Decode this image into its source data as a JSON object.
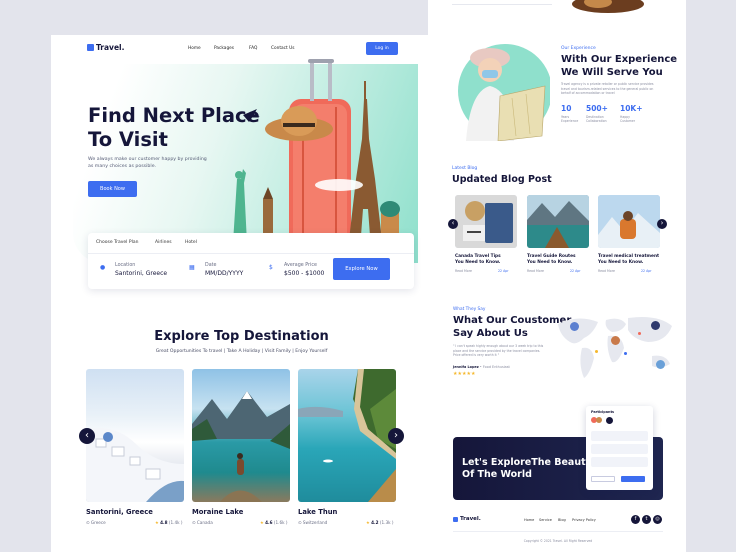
{
  "nav": {
    "logo": "Travel.",
    "links": [
      "Home",
      "Packages",
      "FAQ",
      "Contact Us"
    ],
    "login": "Log in"
  },
  "hero": {
    "title_line1": "Find Next Place",
    "title_line2": "To Visit",
    "subtitle_line1": "We always make our customer happy by providing",
    "subtitle_line2": "as many choices as possible.",
    "cta": "Book Now"
  },
  "search": {
    "tabs": [
      "Choose Travel Plan",
      "Airlines",
      "Hotel"
    ],
    "location_label": "Location",
    "location_value": "Santorini, Greece",
    "date_label": "Date",
    "date_value": "MM/DD/YYYY",
    "price_label": "Average Price",
    "price_value": "$500 - $1000",
    "button": "Explore Now"
  },
  "explore": {
    "title": "Explore Top Destination",
    "subtitle": "Great Opportunities To travel | Take A Holiday | Visit Family | Enjoy Yourself",
    "destinations": [
      {
        "name": "Santorini, Greece",
        "country": "Greece",
        "rating": "4.8",
        "reviews": "(1.4k )"
      },
      {
        "name": "Moraine Lake",
        "country": "Canada",
        "rating": "4.6",
        "reviews": "(1.6k )"
      },
      {
        "name": "Lake Thun",
        "country": "Switzerland",
        "rating": "4.2",
        "reviews": "(1.3k )"
      }
    ]
  },
  "experience": {
    "label": "Our Experience",
    "title_line1": "With Our Experience",
    "title_line2": "We Will Serve You",
    "desc_line1": "Travel agency is a private retailer or public service provides",
    "desc_line2": "travel and tourism-related services to the general public on",
    "desc_line3": "behalf of accommodation or travel",
    "stats": [
      {
        "value": "10",
        "label_line1": "Years",
        "label_line2": "Experience"
      },
      {
        "value": "500+",
        "label_line1": "Destination",
        "label_line2": "Collaboration"
      },
      {
        "value": "10K+",
        "label_line1": "Happy",
        "label_line2": "Customer"
      }
    ]
  },
  "blog": {
    "label": "Latest Blog",
    "title": "Updated Blog Post",
    "posts": [
      {
        "title_line1": "Canada Travel Tips",
        "title_line2": "You Need to Know.",
        "read": "Read More",
        "date": "22 Apr"
      },
      {
        "title_line1": "Travel Guide Routes",
        "title_line2": "You Need to Know.",
        "read": "Read More",
        "date": "22 Apr"
      },
      {
        "title_line1": "Travel medical treatment",
        "title_line2": "You Need to Know.",
        "read": "Read More",
        "date": "22 Apr"
      }
    ]
  },
  "testimonial": {
    "label": "What They Say",
    "title_line1": "What Our Coustomer",
    "title_line2": "Say About Us",
    "quote_line1": "\" I can't speak highly enough about our 3 week trip to this",
    "quote_line2": "place and the service provided by the travel companies.",
    "quote_line3": "Price offered is very worth it \"",
    "author": "Jennifa Lopez",
    "role": "• Food Enthusiast"
  },
  "cta": {
    "line1": "Let's ExploreThe Beauty",
    "line2": "Of The World",
    "participants": "Participants"
  },
  "footer": {
    "logo": "Travel.",
    "links": [
      "Home",
      "Service",
      "Blog",
      "Privacy Policy"
    ],
    "copyright": "Copyright © 2021 Travel. All Right Reserved"
  },
  "colors": {
    "accent": "#3d6df0",
    "dark": "#15163a",
    "mint": "#8fe0cc",
    "star": "#f5b82e"
  }
}
